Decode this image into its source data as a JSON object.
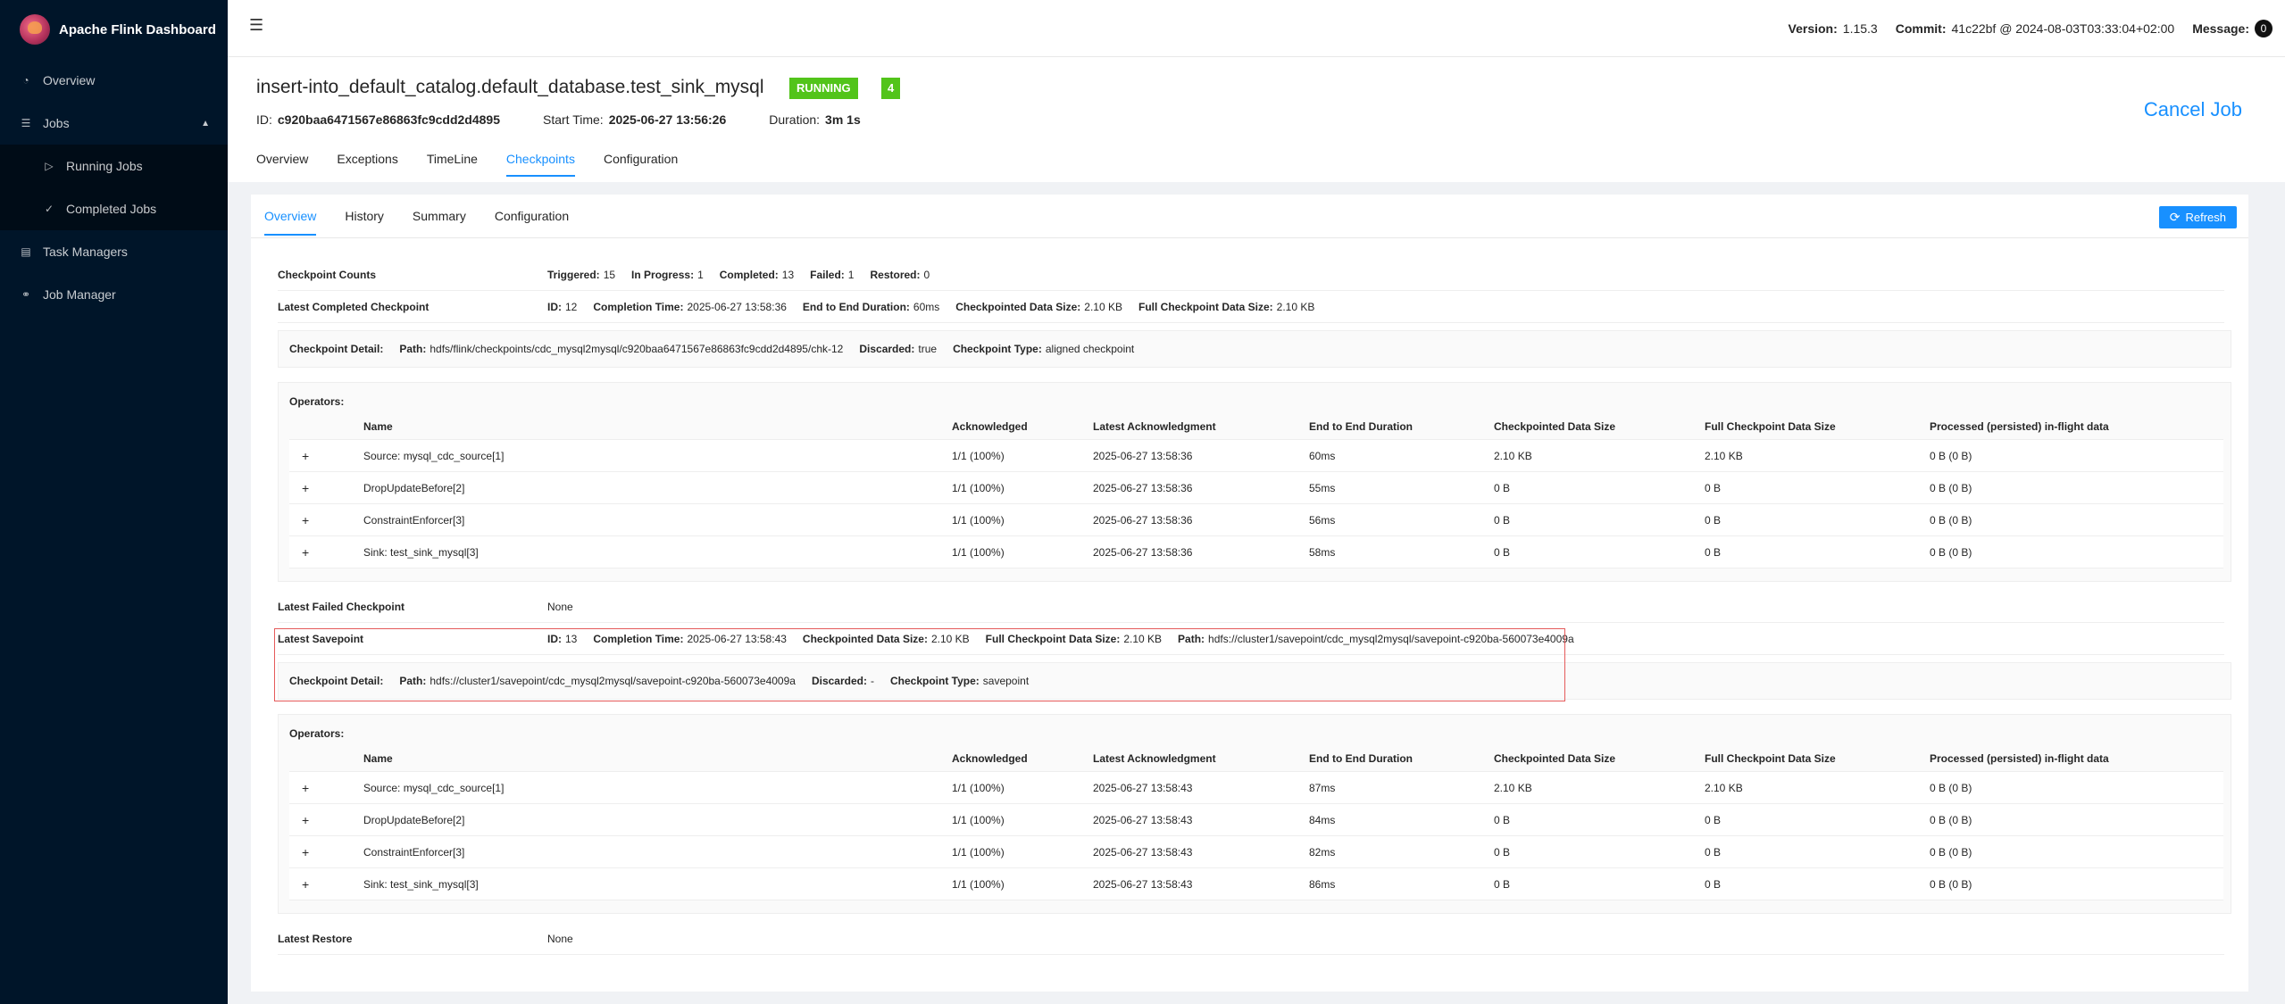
{
  "app": {
    "title": "Apache Flink Dashboard"
  },
  "sidebar": {
    "items": [
      {
        "label": "Overview",
        "icon": "dashboard-icon"
      },
      {
        "label": "Jobs",
        "icon": "bars-icon"
      },
      {
        "label": "Running Jobs",
        "icon": "play-circle-icon"
      },
      {
        "label": "Completed Jobs",
        "icon": "check-circle-icon"
      },
      {
        "label": "Task Managers",
        "icon": "schedule-icon"
      },
      {
        "label": "Job Manager",
        "icon": "cluster-icon"
      }
    ]
  },
  "header": {
    "version_label": "Version:",
    "version": "1.15.3",
    "commit_label": "Commit:",
    "commit": "41c22bf @ 2024-08-03T03:33:04+02:00",
    "message_label": "Message:",
    "message_count": "0"
  },
  "job": {
    "title": "insert-into_default_catalog.default_database.test_sink_mysql",
    "status": "RUNNING",
    "task_count": "4",
    "id_label": "ID:",
    "id": "c920baa6471567e86863fc9cdd2d4895",
    "start_label": "Start Time:",
    "start": "2025-06-27 13:56:26",
    "duration_label": "Duration:",
    "duration": "3m 1s",
    "cancel_label": "Cancel Job",
    "tabs": [
      "Overview",
      "Exceptions",
      "TimeLine",
      "Checkpoints",
      "Configuration"
    ]
  },
  "checkpoints": {
    "tabs": [
      "Overview",
      "History",
      "Summary",
      "Configuration"
    ],
    "refresh_label": "Refresh",
    "counts": {
      "label": "Checkpoint Counts",
      "triggered_label": "Triggered:",
      "triggered": "15",
      "in_progress_label": "In Progress:",
      "in_progress": "1",
      "completed_label": "Completed:",
      "completed": "13",
      "failed_label": "Failed:",
      "failed": "1",
      "restored_label": "Restored:",
      "restored": "0"
    },
    "latest_completed": {
      "label": "Latest Completed Checkpoint",
      "id_label": "ID:",
      "id": "12",
      "completion_label": "Completion Time:",
      "completion": "2025-06-27 13:58:36",
      "e2e_label": "End to End Duration:",
      "e2e": "60ms",
      "size_label": "Checkpointed Data Size:",
      "size": "2.10 KB",
      "full_size_label": "Full Checkpoint Data Size:",
      "full_size": "2.10 KB",
      "detail": {
        "label": "Checkpoint Detail:",
        "path_label": "Path:",
        "path": "hdfs/flink/checkpoints/cdc_mysql2mysql/c920baa6471567e86863fc9cdd2d4895/chk-12",
        "discarded_label": "Discarded:",
        "discarded": "true",
        "type_label": "Checkpoint Type:",
        "type": "aligned checkpoint"
      }
    },
    "operators_label": "Operators:",
    "columns": [
      "Name",
      "Acknowledged",
      "Latest Acknowledgment",
      "End to End Duration",
      "Checkpointed Data Size",
      "Full Checkpoint Data Size",
      "Processed (persisted) in-flight data"
    ],
    "completed_ops": [
      {
        "name": "Source: mysql_cdc_source[1]",
        "ack": "1/1 (100%)",
        "latest": "2025-06-27 13:58:36",
        "e2e": "60ms",
        "size": "2.10 KB",
        "full": "2.10 KB",
        "inflight": "0 B (0 B)"
      },
      {
        "name": "DropUpdateBefore[2]",
        "ack": "1/1 (100%)",
        "latest": "2025-06-27 13:58:36",
        "e2e": "55ms",
        "size": "0 B",
        "full": "0 B",
        "inflight": "0 B (0 B)"
      },
      {
        "name": "ConstraintEnforcer[3]",
        "ack": "1/1 (100%)",
        "latest": "2025-06-27 13:58:36",
        "e2e": "56ms",
        "size": "0 B",
        "full": "0 B",
        "inflight": "0 B (0 B)"
      },
      {
        "name": "Sink: test_sink_mysql[3]",
        "ack": "1/1 (100%)",
        "latest": "2025-06-27 13:58:36",
        "e2e": "58ms",
        "size": "0 B",
        "full": "0 B",
        "inflight": "0 B (0 B)"
      }
    ],
    "latest_failed": {
      "label": "Latest Failed Checkpoint",
      "value": "None"
    },
    "latest_savepoint": {
      "label": "Latest Savepoint",
      "id_label": "ID:",
      "id": "13",
      "completion_label": "Completion Time:",
      "completion": "2025-06-27 13:58:43",
      "size_label": "Checkpointed Data Size:",
      "size": "2.10 KB",
      "full_size_label": "Full Checkpoint Data Size:",
      "full_size": "2.10 KB",
      "path_label": "Path:",
      "path": "hdfs://cluster1/savepoint/cdc_mysql2mysql/savepoint-c920ba-560073e4009a",
      "detail": {
        "label": "Checkpoint Detail:",
        "path_label": "Path:",
        "path": "hdfs://cluster1/savepoint/cdc_mysql2mysql/savepoint-c920ba-560073e4009a",
        "discarded_label": "Discarded:",
        "discarded": "-",
        "type_label": "Checkpoint Type:",
        "type": "savepoint"
      }
    },
    "savepoint_ops": [
      {
        "name": "Source: mysql_cdc_source[1]",
        "ack": "1/1 (100%)",
        "latest": "2025-06-27 13:58:43",
        "e2e": "87ms",
        "size": "2.10 KB",
        "full": "2.10 KB",
        "inflight": "0 B (0 B)"
      },
      {
        "name": "DropUpdateBefore[2]",
        "ack": "1/1 (100%)",
        "latest": "2025-06-27 13:58:43",
        "e2e": "84ms",
        "size": "0 B",
        "full": "0 B",
        "inflight": "0 B (0 B)"
      },
      {
        "name": "ConstraintEnforcer[3]",
        "ack": "1/1 (100%)",
        "latest": "2025-06-27 13:58:43",
        "e2e": "82ms",
        "size": "0 B",
        "full": "0 B",
        "inflight": "0 B (0 B)"
      },
      {
        "name": "Sink: test_sink_mysql[3]",
        "ack": "1/1 (100%)",
        "latest": "2025-06-27 13:58:43",
        "e2e": "86ms",
        "size": "0 B",
        "full": "0 B",
        "inflight": "0 B (0 B)"
      }
    ],
    "latest_restore": {
      "label": "Latest Restore",
      "value": "None"
    }
  }
}
